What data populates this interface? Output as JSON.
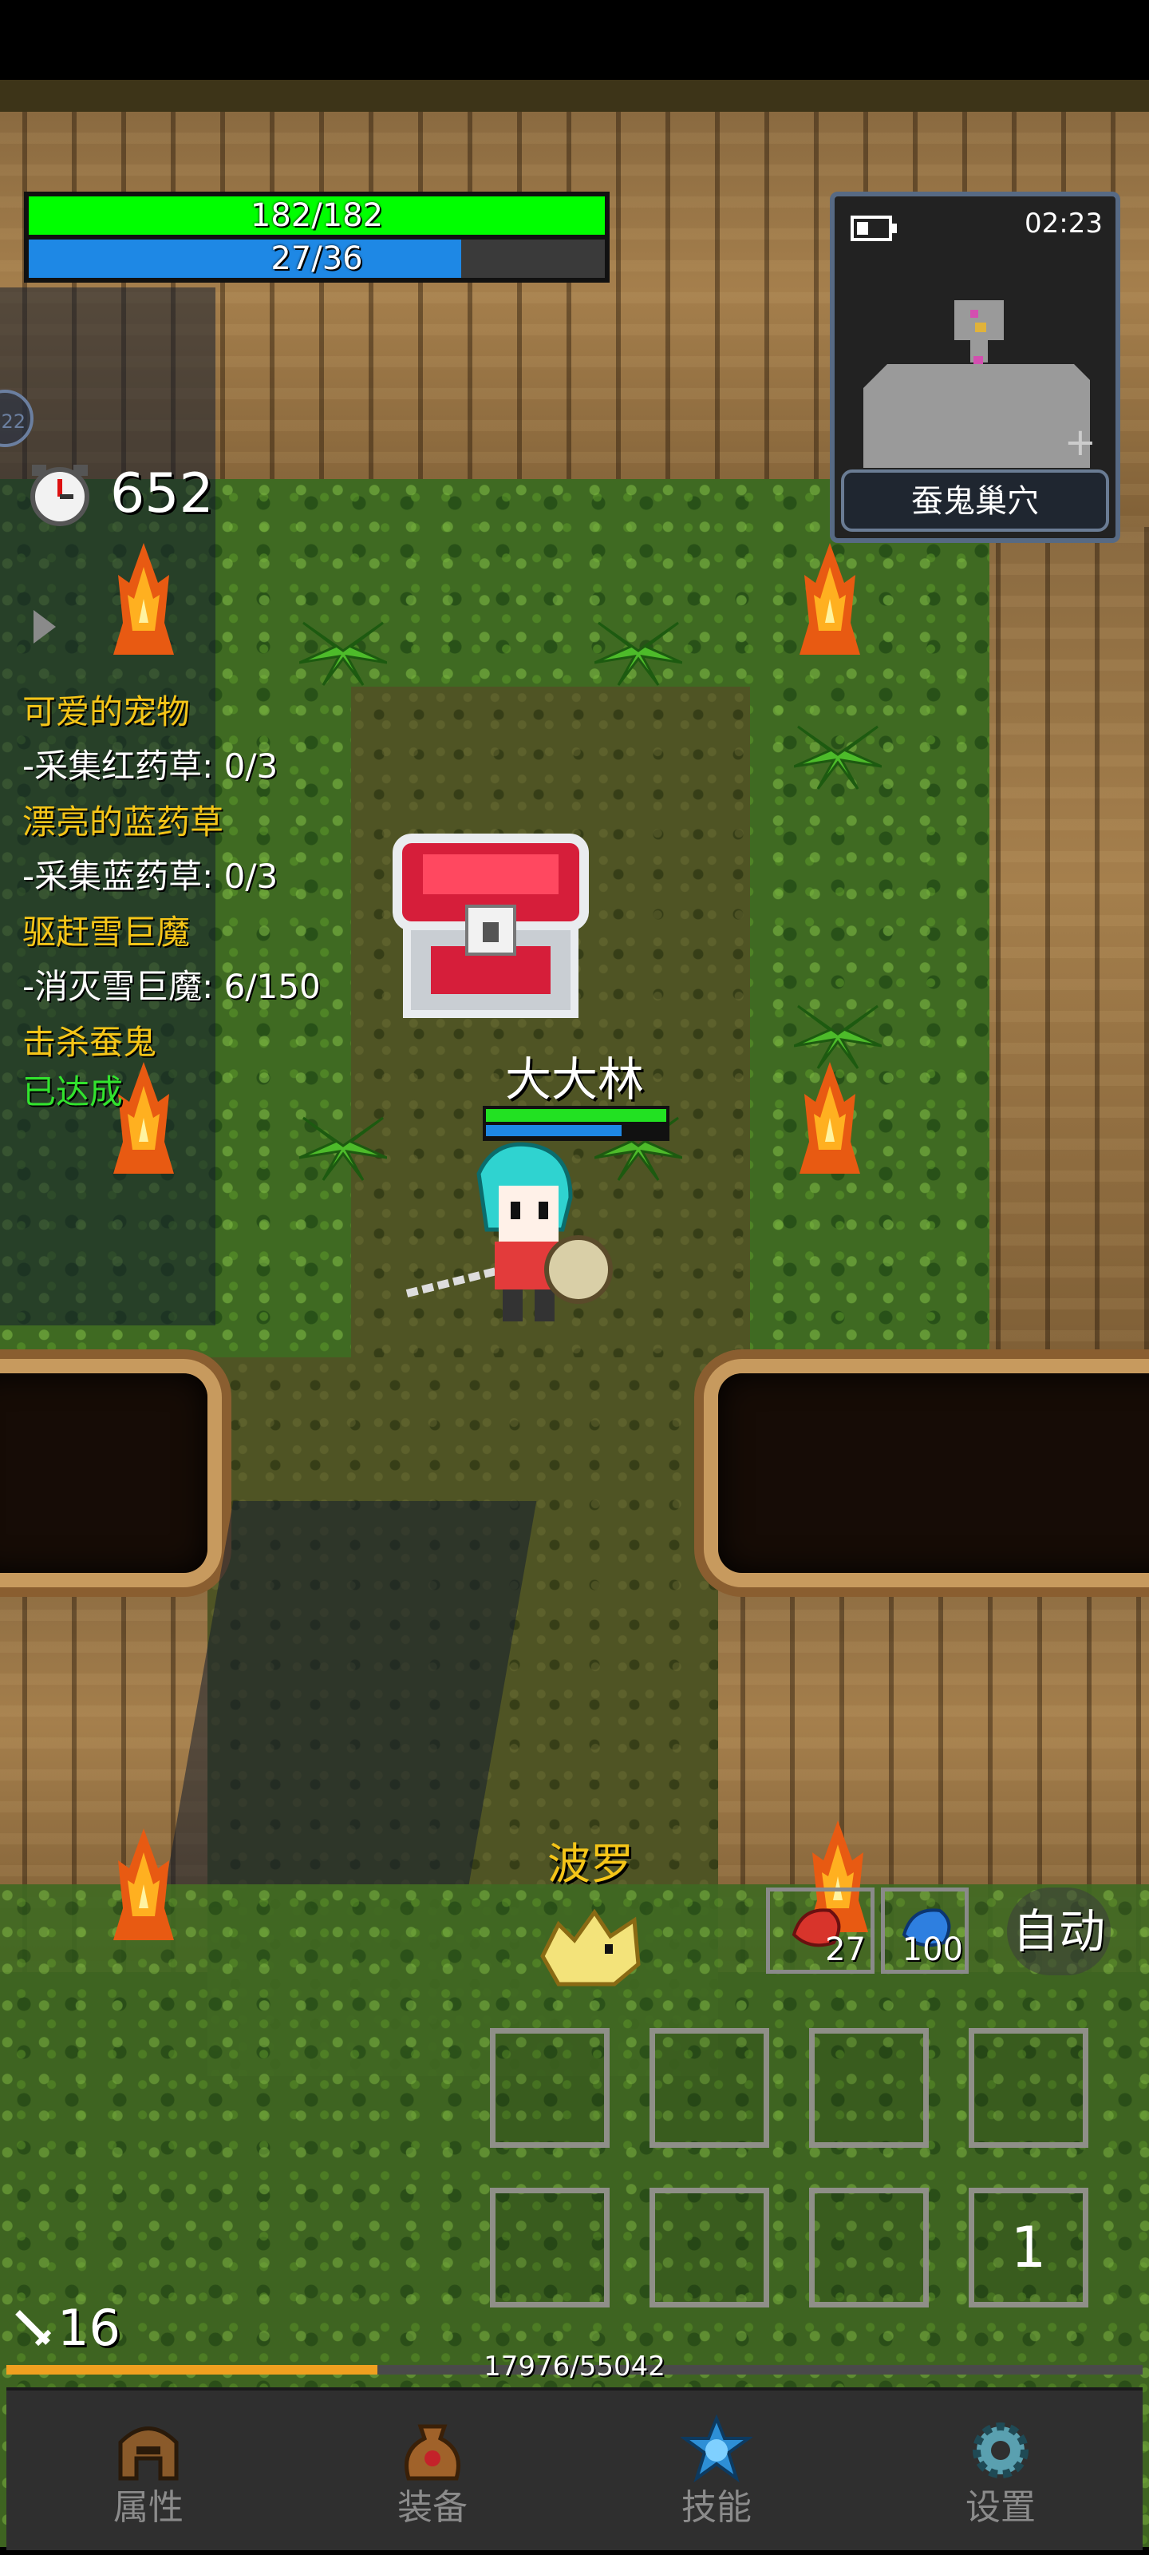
{
  "hud": {
    "hp_text": "182/182",
    "hp_fraction": 1.0,
    "mp_text": "27/36",
    "mp_fraction": 0.75,
    "timer_value": "652",
    "side_badge": "22"
  },
  "minimap": {
    "time": "02:23",
    "location": "蚕鬼巢穴"
  },
  "quests": [
    {
      "title": "可爱的宠物",
      "detail": "-采集红药草: 0/3"
    },
    {
      "title": "漂亮的蓝药草",
      "detail": "-采集蓝药草: 0/3"
    },
    {
      "title": "驱赶雪巨魔",
      "detail": "-消灭雪巨魔: 6/150"
    },
    {
      "title": "击杀蚕鬼",
      "detail": "已达成"
    }
  ],
  "player": {
    "name": "大大林",
    "hp_fraction": 1.0,
    "mp_fraction": 0.75
  },
  "pet": {
    "name": "波罗"
  },
  "potions": {
    "red_count": "27",
    "blue_count": "100",
    "auto_label": "自动"
  },
  "skill_slots": {
    "page_number": "1"
  },
  "stats": {
    "attack_level": "16",
    "exp_text": "17976/55042",
    "exp_fraction": 0.3266
  },
  "nav": [
    {
      "label": "属性",
      "icon": "helmet-icon"
    },
    {
      "label": "装备",
      "icon": "bag-icon"
    },
    {
      "label": "技能",
      "icon": "skill-gem-icon"
    },
    {
      "label": "设置",
      "icon": "gear-icon"
    }
  ],
  "colors": {
    "hp": "#00ff00",
    "mp": "#1e88e5",
    "quest_title": "#f5c518",
    "quest_done": "#32e32e",
    "exp_bar": "#f0a020"
  }
}
